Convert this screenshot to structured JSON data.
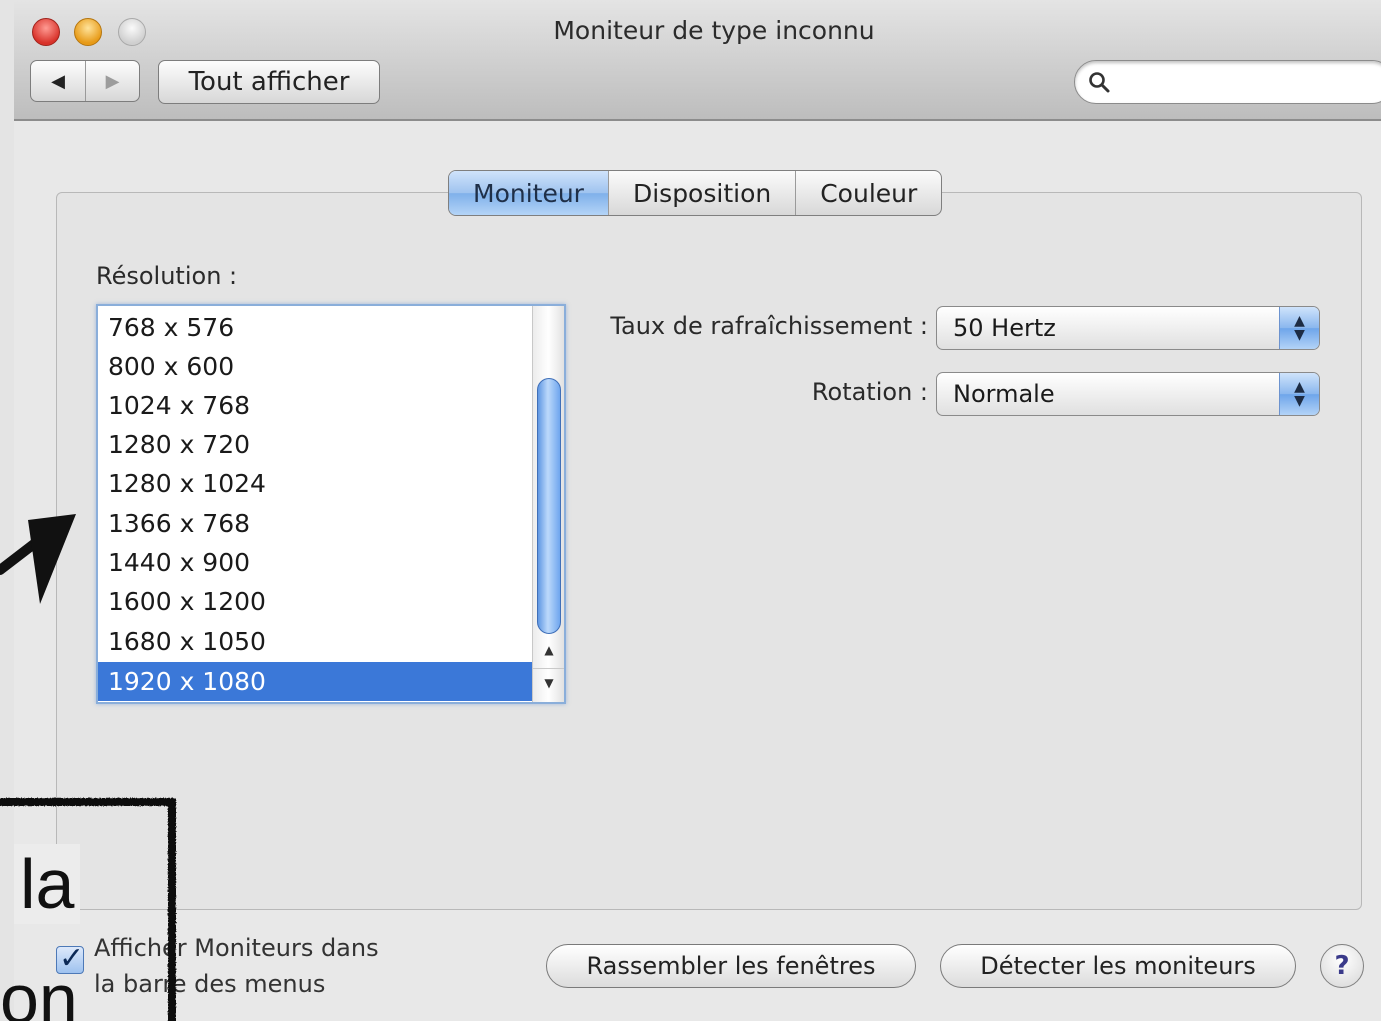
{
  "window": {
    "title": "Moniteur de type inconnu"
  },
  "toolbar": {
    "back_icon": "◀",
    "forward_icon": "▶",
    "show_all_label": "Tout afficher",
    "search": {
      "placeholder": "",
      "value": ""
    }
  },
  "tabs": [
    {
      "label": "Moniteur",
      "selected": true
    },
    {
      "label": "Disposition",
      "selected": false
    },
    {
      "label": "Couleur",
      "selected": false
    }
  ],
  "resolution": {
    "label": "Résolution :",
    "items": [
      "768 x 576",
      "800 x 600",
      "1024 x 768",
      "1280 x 720",
      "1280 x 1024",
      "1366 x 768",
      "1440 x 900",
      "1600 x 1200",
      "1680 x 1050",
      "1920 x 1080"
    ],
    "selected": "1920 x 1080"
  },
  "refresh_rate": {
    "label": "Taux de rafraîchissement :",
    "value": "50 Hertz"
  },
  "rotation": {
    "label": "Rotation :",
    "value": "Normale"
  },
  "footer": {
    "show_in_menu_bar_label_line1": "Afficher Moniteurs dans",
    "show_in_menu_bar_label_line2": "la barre des menus",
    "show_in_menu_bar_checked": true,
    "gather_windows_label": "Rassembler les fenêtres",
    "detect_displays_label": "Détecter les moniteurs",
    "help_label": "?"
  },
  "annotation": {
    "text_line1": "la",
    "text_line2": "on"
  },
  "colors": {
    "selection": "#3b78d8",
    "close": "#d8322a",
    "minimize": "#e79a17",
    "zoom": "#cfcfcf"
  }
}
